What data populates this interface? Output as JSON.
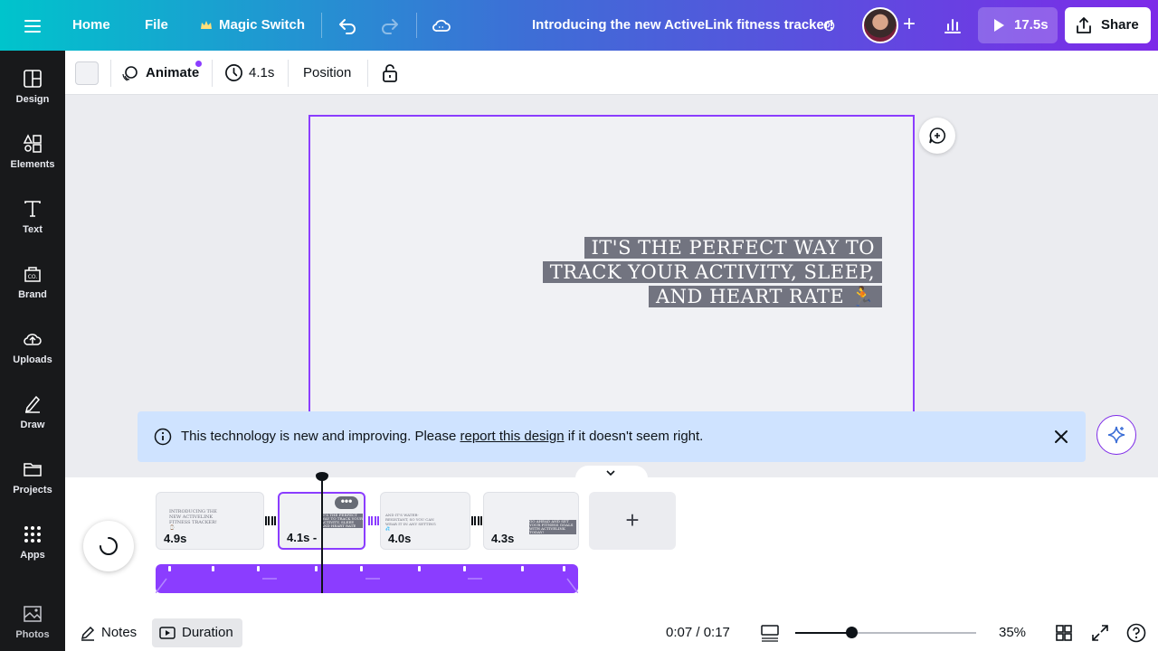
{
  "topbar": {
    "home": "Home",
    "file": "File",
    "magic_switch": "Magic Switch",
    "title": "Introducing the new ActiveLink fitness tracker!",
    "play_duration": "17.5s",
    "share": "Share"
  },
  "sidebar": {
    "items": [
      {
        "label": "Design",
        "icon": "design-icon"
      },
      {
        "label": "Elements",
        "icon": "elements-icon"
      },
      {
        "label": "Text",
        "icon": "text-icon"
      },
      {
        "label": "Brand",
        "icon": "brand-icon"
      },
      {
        "label": "Uploads",
        "icon": "uploads-icon"
      },
      {
        "label": "Draw",
        "icon": "draw-icon"
      },
      {
        "label": "Projects",
        "icon": "folder-icon"
      },
      {
        "label": "Apps",
        "icon": "apps-icon"
      },
      {
        "label": "Photos",
        "icon": "photos-icon"
      }
    ]
  },
  "toolbar": {
    "animate": "Animate",
    "duration": "4.1s",
    "position": "Position"
  },
  "canvas": {
    "line1": "IT'S THE PERFECT WAY TO",
    "line2": "TRACK YOUR ACTIVITY, SLEEP,",
    "line3": "AND HEART RATE 🏃"
  },
  "notice": {
    "before": "This technology is new and improving. Please ",
    "link": "report this design",
    "after": " if it doesn't seem right."
  },
  "timeline": {
    "pages": [
      {
        "duration": "4.9s",
        "text": "INTRODUCING THE NEW ACTIVELINK FITNESS TRACKER! ⌚"
      },
      {
        "duration": "4.1s -",
        "text": "IT'S THE PERFECT WAY TO TRACK YOUR ACTIVITY, SLEEP, AND HEART RATE"
      },
      {
        "duration": "4.0s",
        "text": "AND IT'S WATER-RESISTANT, SO YOU CAN WEAR IT IN ANY SETTING 💦"
      },
      {
        "duration": "4.3s",
        "text": "GO AHEAD AND SET YOUR FITNESS GOALS WITH ACTIVELINK TODAY!"
      }
    ],
    "more": "•••"
  },
  "footer": {
    "notes": "Notes",
    "duration": "Duration",
    "time": "0:07 / 0:17",
    "zoom": "35%"
  },
  "colors": {
    "accent": "#8b3dff",
    "sidebar_bg": "#18191b",
    "notice_bg": "#cfe3ff"
  }
}
